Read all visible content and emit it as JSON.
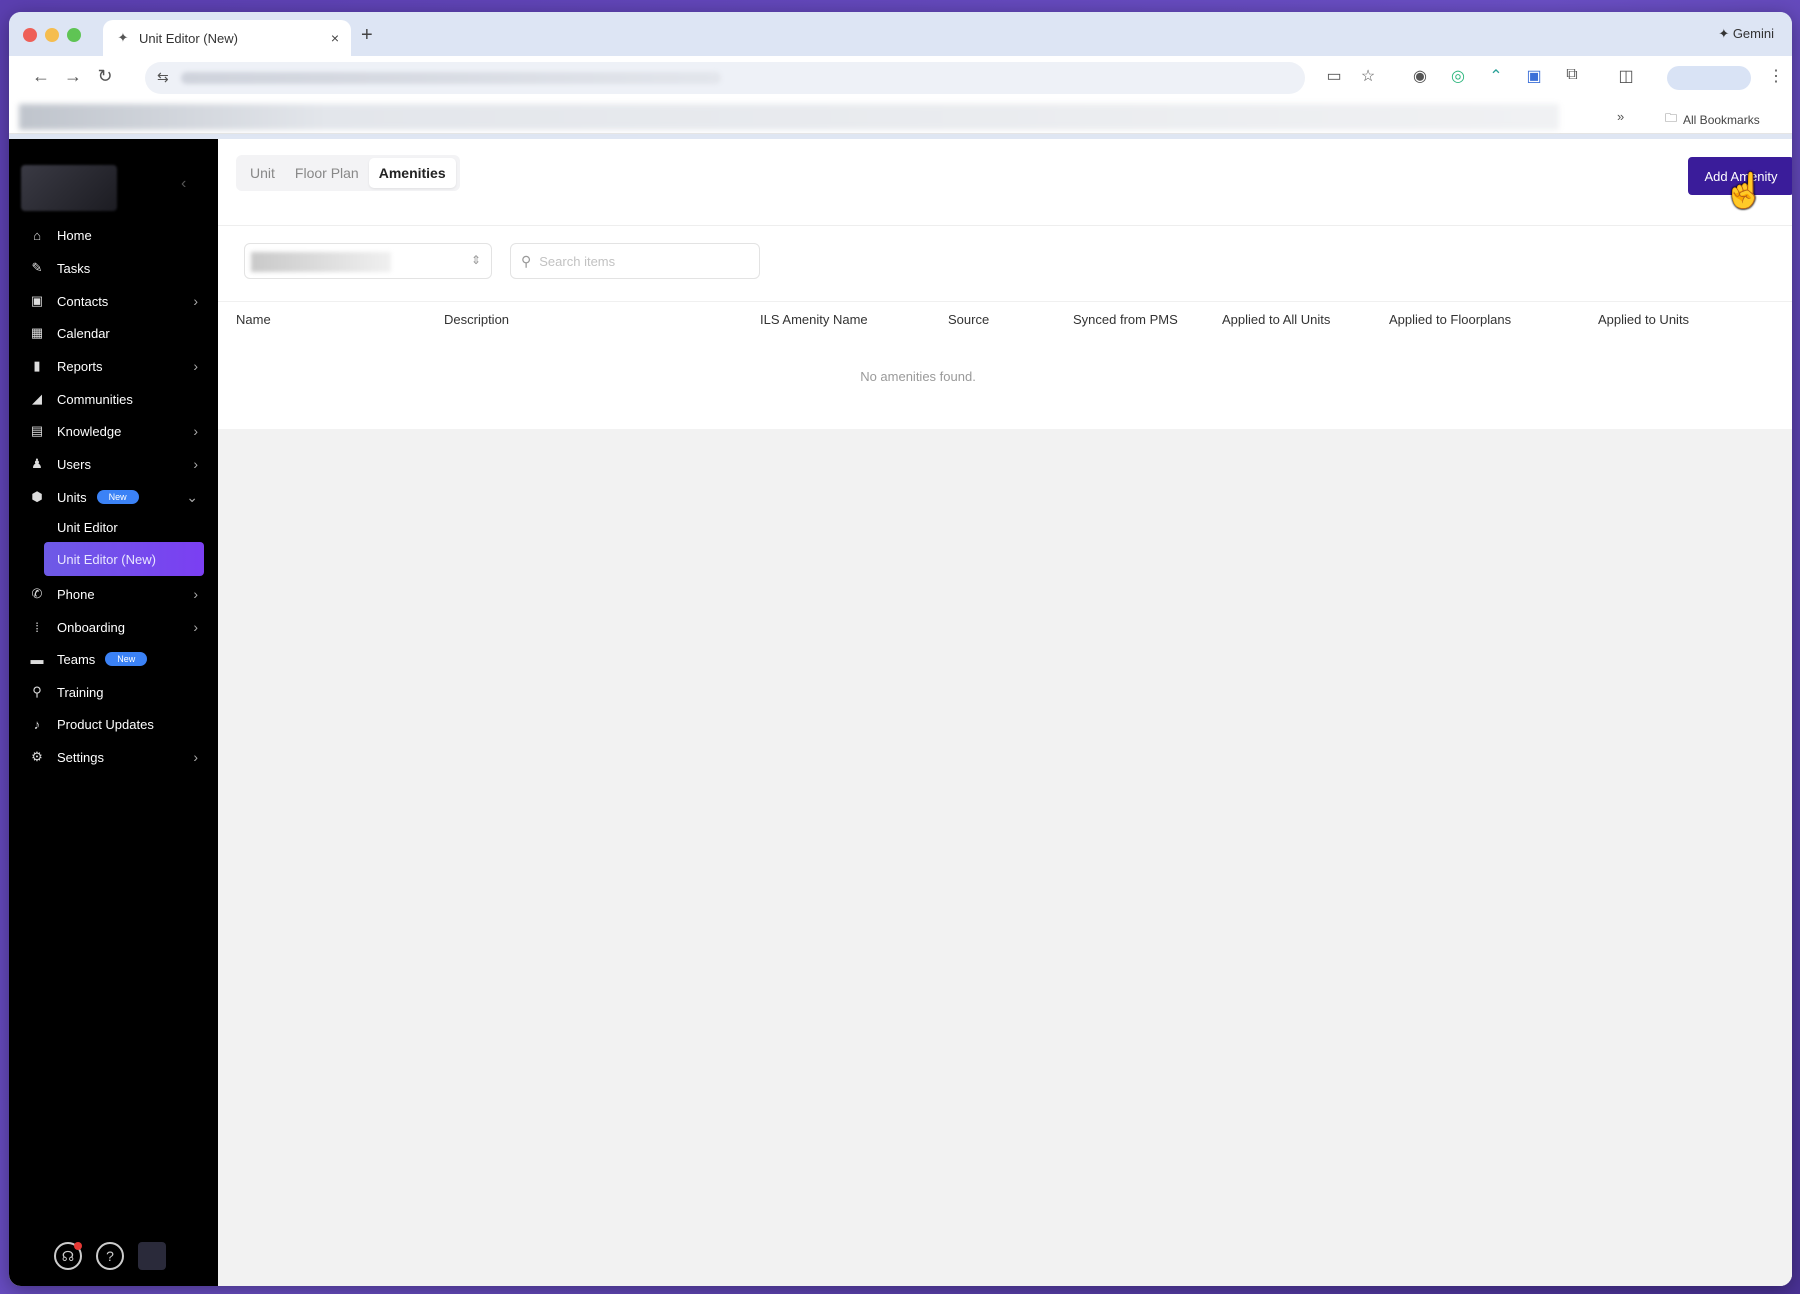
{
  "browser": {
    "tab_title": "Unit Editor (New)",
    "tab_close": "×",
    "new_tab": "+",
    "gemini_label": "✦ Gemini",
    "all_bookmarks": "All Bookmarks",
    "bookmarks_more": "»"
  },
  "sidebar": {
    "collapse_icon": "‹",
    "items": [
      {
        "label": "Home",
        "icon": "home-icon",
        "glyph": "⌂",
        "chevron": false
      },
      {
        "label": "Tasks",
        "icon": "tasks-icon",
        "glyph": "✎",
        "chevron": false
      },
      {
        "label": "Contacts",
        "icon": "contacts-icon",
        "glyph": "▣",
        "chevron": true
      },
      {
        "label": "Calendar",
        "icon": "calendar-icon",
        "glyph": "▦",
        "chevron": false
      },
      {
        "label": "Reports",
        "icon": "reports-icon",
        "glyph": "▮",
        "chevron": true
      },
      {
        "label": "Communities",
        "icon": "communities-icon",
        "glyph": "◢",
        "chevron": false
      },
      {
        "label": "Knowledge",
        "icon": "knowledge-icon",
        "glyph": "▤",
        "chevron": true
      },
      {
        "label": "Users",
        "icon": "users-icon",
        "glyph": "♟",
        "chevron": true
      },
      {
        "label": "Units",
        "icon": "units-icon",
        "glyph": "⬢",
        "chevron": true,
        "badge": "New"
      },
      {
        "label": "Phone",
        "icon": "phone-icon",
        "glyph": "✆",
        "chevron": true
      },
      {
        "label": "Onboarding",
        "icon": "onboarding-icon",
        "glyph": "⁞",
        "chevron": true
      },
      {
        "label": "Teams",
        "icon": "teams-icon",
        "glyph": "▬",
        "chevron": false,
        "badge": "New"
      },
      {
        "label": "Training",
        "icon": "training-icon",
        "glyph": "⚲",
        "chevron": false
      },
      {
        "label": "Product Updates",
        "icon": "bell-icon",
        "glyph": "♪",
        "chevron": false
      },
      {
        "label": "Settings",
        "icon": "settings-icon",
        "glyph": "⚙",
        "chevron": true
      }
    ],
    "sub_items": [
      {
        "label": "Unit Editor"
      },
      {
        "label": "Unit Editor (New)"
      }
    ]
  },
  "main": {
    "tabs": [
      {
        "label": "Unit",
        "active": false
      },
      {
        "label": "Floor Plan",
        "active": false
      },
      {
        "label": "Amenities",
        "active": true
      }
    ],
    "add_button": "Add Amenity",
    "search_placeholder": "Search items",
    "columns": [
      "Name",
      "Description",
      "ILS Amenity Name",
      "Source",
      "Synced from PMS",
      "Applied to All Units",
      "Applied to Floorplans",
      "Applied to Units"
    ],
    "empty_message": "No amenities found."
  },
  "colors": {
    "accent": "#3a1c9a",
    "active_nav": "#7b3ff2",
    "badge": "#3b82f6"
  }
}
